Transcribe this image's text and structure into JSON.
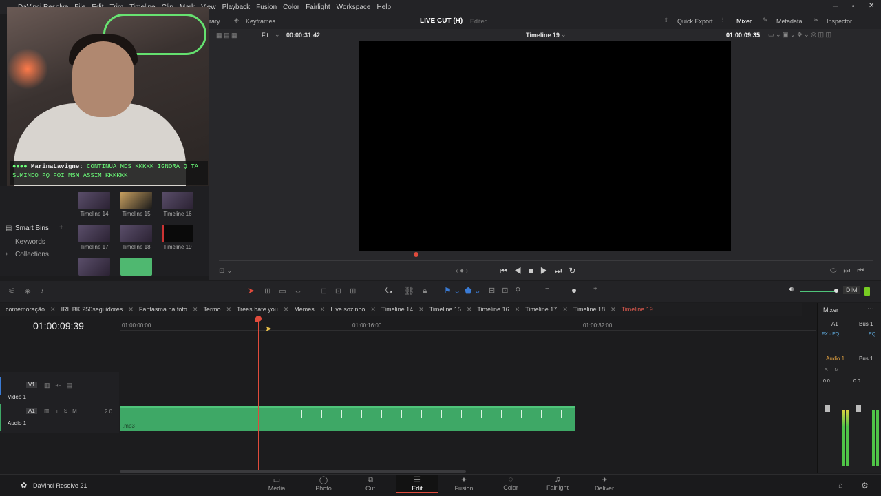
{
  "menu": [
    "DaVinci Resolve",
    "File",
    "Edit",
    "Trim",
    "Timeline",
    "Clip",
    "Mark",
    "View",
    "Playback",
    "Fusion",
    "Color",
    "Fairlight",
    "Workspace",
    "Help"
  ],
  "toolbar": {
    "library": "rary",
    "keyframes": "Keyframes",
    "project_title": "LIVE CUT (H)",
    "edited": "Edited",
    "quick_export": "Quick Export",
    "mixer": "Mixer",
    "metadata": "Metadata",
    "inspector": "Inspector"
  },
  "viewer": {
    "fit": "Fit",
    "src_tc": "00:00:31:42",
    "timeline_name": "Timeline 19",
    "rec_tc": "01:00:09:35"
  },
  "chat": {
    "user": "MarinaLavigne:",
    "message": "CONTINUA MDS KKKKK IGNORA Q TA SUMINDO PQ FOI MSM ASSIM KKKKKK"
  },
  "bins": {
    "smart_bins": "Smart Bins",
    "keywords": "Keywords",
    "collections": "Collections"
  },
  "thumbs": [
    "Timeline 14",
    "Timeline 15",
    "Timeline 16",
    "Timeline 17",
    "Timeline 18",
    "Timeline 19"
  ],
  "tabs": [
    "comemoração",
    "IRL BK 250seguidores",
    "Fantasma na foto",
    "Termo",
    "Trees hate you",
    "Memes",
    "Live sozinho",
    "Timeline 14",
    "Timeline 15",
    "Timeline 16",
    "Timeline 17",
    "Timeline 18",
    "Timeline 19"
  ],
  "timeline": {
    "timecode": "01:00:09:39",
    "ruler": [
      "01:00:00:00",
      "01:00:16:00",
      "01:00:32:00"
    ],
    "v1": "V1",
    "video1": "Video 1",
    "a1": "A1",
    "audio1": "Audio 1",
    "chan": "2.0",
    "clip_name": ".mp3"
  },
  "mixer": {
    "title": "Mixer",
    "a1": "A1",
    "bus1": "Bus 1",
    "audio1": "Audio 1",
    "bus1b": "Bus 1",
    "val": "0.0"
  },
  "dim": "DIM",
  "pages": [
    "Media",
    "Photo",
    "Cut",
    "Edit",
    "Fusion",
    "Color",
    "Fairlight",
    "Deliver"
  ],
  "app_name": "DaVinci Resolve 21"
}
